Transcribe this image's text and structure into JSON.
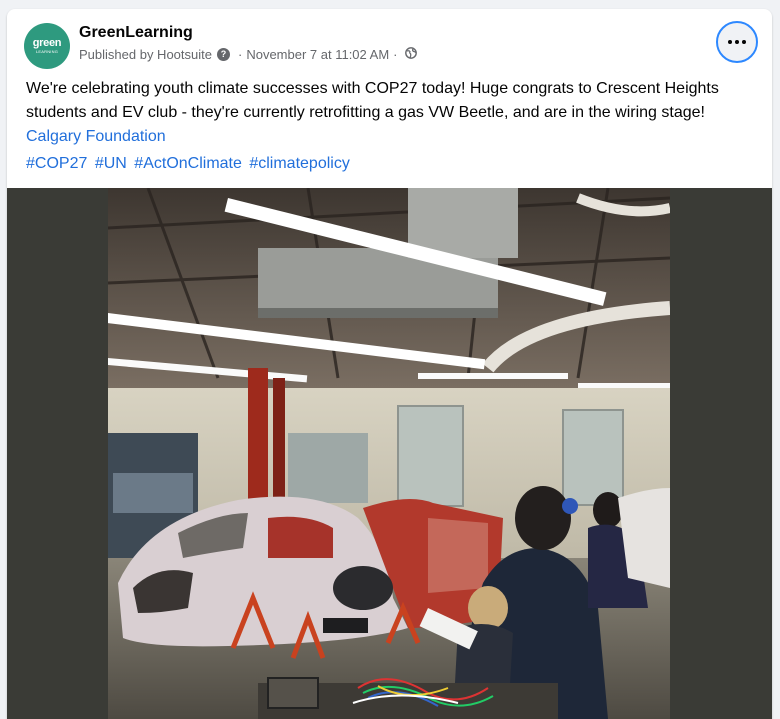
{
  "post": {
    "page_name": "GreenLearning",
    "avatar_text": "green",
    "avatar_subtext": "LEARNING",
    "published_by": "Published by Hootsuite",
    "help_glyph": "?",
    "timestamp": "November 7 at 11:02 AM",
    "separator": "·",
    "privacy_icon": "globe-icon",
    "more_icon": "more-horizontal-icon",
    "body_text": "We're celebrating youth climate successes with COP27 today! Huge congrats to Crescent Heights students and EV club - they're currently retrofitting a gas VW Beetle, and are in the wiring stage!",
    "link_text": "Calgary Foundation",
    "hashtags": [
      "#COP27",
      "#UN",
      "#ActOnClimate",
      "#climatepolicy"
    ]
  },
  "colors": {
    "link": "#216fdb",
    "avatar_bg": "#2e9a7f",
    "focus_ring": "#2d88ff",
    "secondary_text": "#65676b"
  },
  "photo": {
    "subject": "students-working-on-vw-beetle-photo"
  }
}
